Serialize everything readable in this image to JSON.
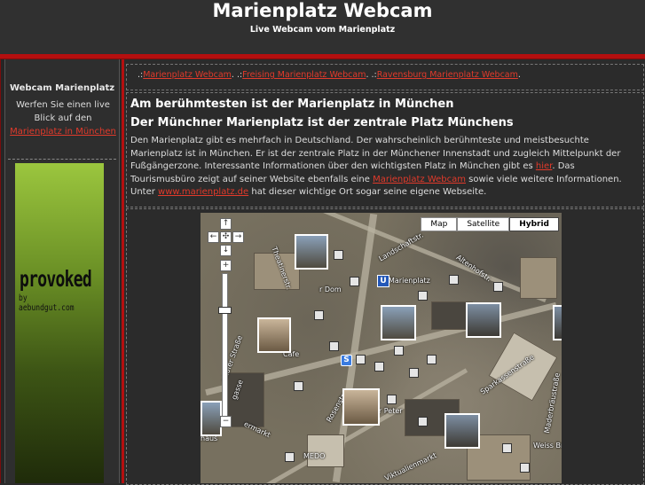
{
  "header": {
    "title": "Marienplatz Webcam",
    "subtitle": "Live Webcam vom Marienplatz"
  },
  "sidebar": {
    "title": "Webcam Marienplatz",
    "text_before": "Werfen Sie einen live Blick auf den ",
    "link": "Marienplatz in München",
    "ad": {
      "brand": "provoked",
      "byline": "by aebundgut.com"
    }
  },
  "nav": {
    "prefix": ".:",
    "sep": ".  .:",
    "end": ".",
    "links": [
      "Marienplatz Webcam",
      "Freising Marienplatz Webcam",
      "Ravensburg Marienplatz Webcam"
    ]
  },
  "main": {
    "heading1": "Am berühmtesten ist der Marienplatz in München",
    "heading2": "Der Münchner Marienplatz ist der zentrale Platz Münchens",
    "paragraph": {
      "part1": "Den Marienplatz gibt es mehrfach in Deutschland. Der wahrscheinlich berühmteste und meistbesuchte Marienplatz ist in München. Er ist der zentrale Platz in der Münchener Innenstadt und zugleich Mittelpunkt der Fußgängerzone. Interessante Informationen über den wichtigsten Platz in München gibt es ",
      "link1": "hier",
      "part2": ". Das Tourismusbüro zeigt auf seiner Website ebenfalls eine ",
      "link2": "Marienplatz Webcam",
      "part3": " sowie viele weitere Informationen. Unter ",
      "link3": "www.marienplatz.de",
      "part4": " hat dieser wichtige Ort sogar seine eigene Webseite."
    }
  },
  "map": {
    "types": [
      "Map",
      "Satellite",
      "Hybrid"
    ],
    "active_type": "Hybrid",
    "labels": {
      "landschaft": "Landschaftstr.",
      "altenhof": "Altenhofstr.",
      "marienplatz": "Marienplatz",
      "dom": "r Dom",
      "theatiner": "Theatinerstr.",
      "sparkassen": "Sparkassenstraße",
      "maderbrau": "Maderbräustraße",
      "peter": "er Peter",
      "rosen": "Rosenstr.",
      "ermarkt": "ermarkt",
      "medo": "MEDO",
      "viktualien": "Viktualienmarkt",
      "weiss": "Weiss Bräu",
      "cafe": "Cafe",
      "haus": "haus",
      "gasse": "gasse",
      "nhof": "nhofer Straße"
    },
    "u_marker": "U",
    "s_marker": "S",
    "zoom_plus": "+",
    "zoom_minus": "−",
    "pan_up": "↑",
    "pan_left": "←",
    "pan_right": "→",
    "pan_down": "↓",
    "pan_center": "✣"
  },
  "colors": {
    "accent": "#b50f0f",
    "link": "#e23a2b",
    "background": "#2b2b2b"
  }
}
